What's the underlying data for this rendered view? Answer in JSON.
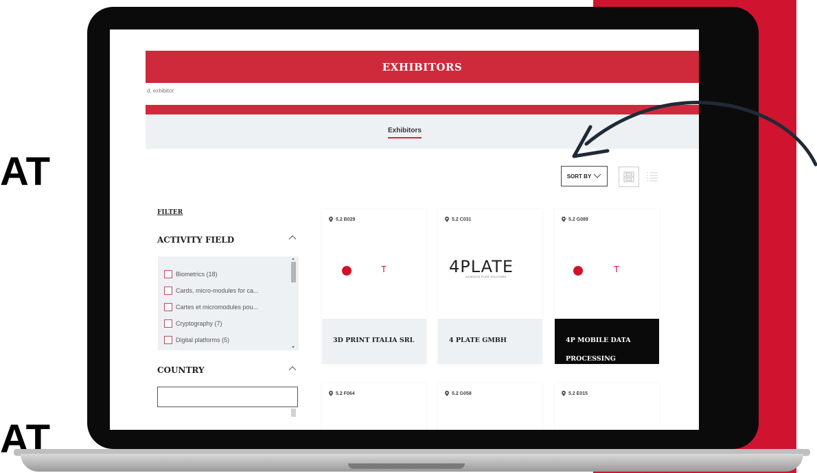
{
  "side_text": [
    "AT",
    "AT"
  ],
  "header": {
    "title": "EXHIBITORS"
  },
  "search": {
    "placeholder": "d, exhibitor"
  },
  "tabs": [
    {
      "label": "Exhibitors"
    }
  ],
  "toolbar": {
    "sort_label": "SORT BY"
  },
  "filter": {
    "label": "FILTER",
    "activity_field": {
      "title": "ACTIVITY FIELD",
      "items": [
        {
          "label": "Biometrics  (18)"
        },
        {
          "label": "Cards, micro-modules for ca..."
        },
        {
          "label": "Cartes et micromodules pou..."
        },
        {
          "label": "Cryptography  (7)"
        },
        {
          "label": "Digital platforms  (5)"
        }
      ]
    },
    "country": {
      "title": "COUNTRY"
    }
  },
  "exhibitors": [
    {
      "location": "5.2 B029",
      "name": "3D PRINT ITALIA SRL",
      "logo": "red-dot-t"
    },
    {
      "location": "5.2 C031",
      "name": "4 PLATE GMBH",
      "logo": "4plate",
      "logo_text": "4PLATE",
      "logo_sub": "ADVANCED PLATE SOLUTIONS"
    },
    {
      "location": "5.2 G089",
      "name": "4P MOBILE DATA PROCESSING",
      "logo": "red-dot-t"
    },
    {
      "location": "5.2 F064"
    },
    {
      "location": "5.2 G058"
    },
    {
      "location": "5.2 E015"
    }
  ],
  "colors": {
    "brand_red": "#cf2a3c",
    "band_red": "#d0142f",
    "panel_bg": "#edf1f4"
  }
}
